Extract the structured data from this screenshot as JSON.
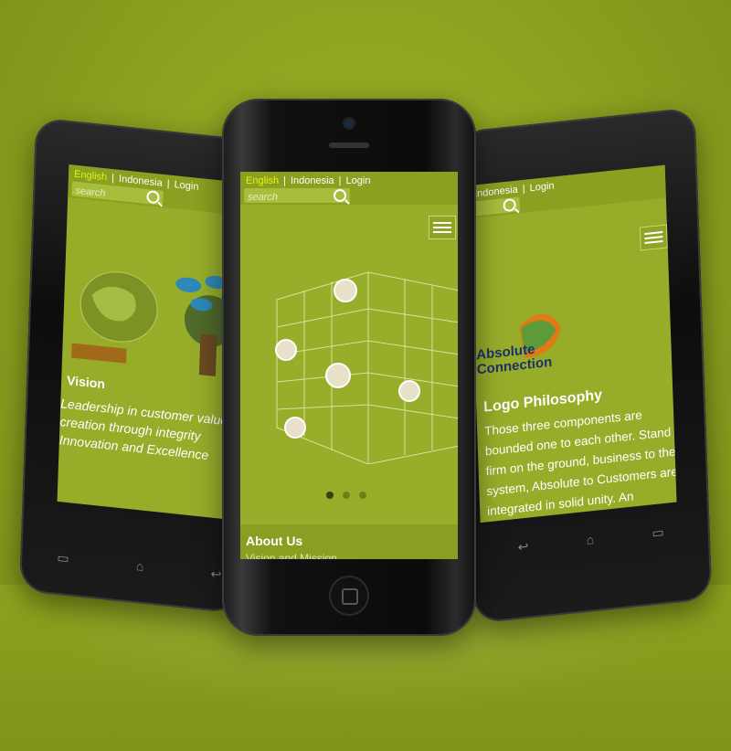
{
  "nav": {
    "english": "English",
    "indonesia": "Indonesia",
    "login": "Login",
    "search_placeholder": "search"
  },
  "left_screen": {
    "vision_title": "Vision",
    "vision_line1": "Leadership in customer value",
    "vision_line2": "creation through integrity",
    "vision_line3": "Innovation and Excellence"
  },
  "center_screen": {
    "about_title": "About Us",
    "about_subtitle": "Vision and Mission",
    "slider_total": 3,
    "slider_active": 1
  },
  "right_screen": {
    "logo_word1": "Absolute",
    "logo_word2": "Connection",
    "philosophy_title": "Logo Philosophy",
    "philosophy_text": "Those three components are bounded one to each other. Stand firm on the ground, business to the system, Absolute to Customers are integrated in solid unity. An Absolute Connection"
  },
  "colors": {
    "background": "#8aa01f",
    "screen": "#97ad2a",
    "active_lang": "#e6f20f"
  }
}
